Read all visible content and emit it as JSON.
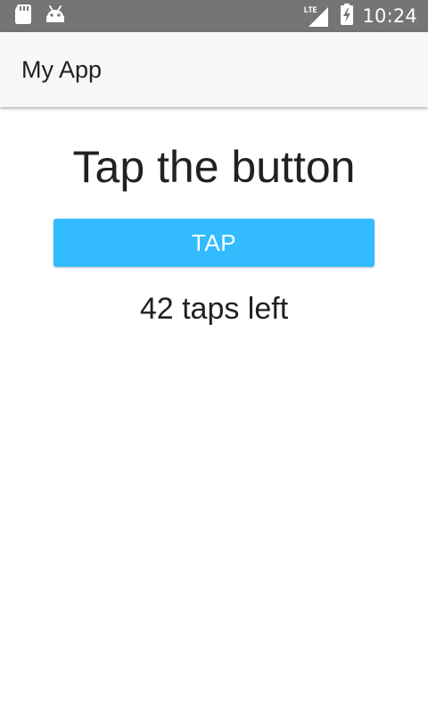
{
  "status_bar": {
    "time": "10:24",
    "network_type": "LTE",
    "icons": [
      "sd-card-icon",
      "android-icon",
      "signal-icon",
      "battery-charging-icon"
    ],
    "background_color": "#757575"
  },
  "app_bar": {
    "title": "My App",
    "background_color": "#f7f7f7"
  },
  "main": {
    "heading": "Tap the button",
    "button_label": "TAP",
    "button_color": "#33bbff",
    "counter_text": "42 taps left"
  }
}
